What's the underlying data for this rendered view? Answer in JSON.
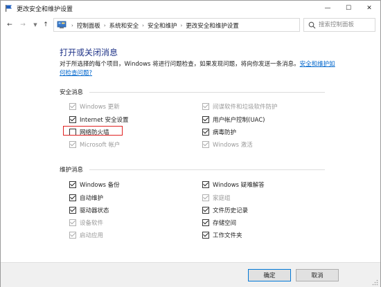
{
  "window": {
    "title": "更改安全和维护设置",
    "controls": {
      "minimize": "—",
      "maximize": "☐",
      "close": "✕"
    }
  },
  "nav": {
    "back": "←",
    "forward": "→",
    "up": "↑",
    "breadcrumbs": [
      "控制面板",
      "系统和安全",
      "安全和维护",
      "更改安全和维护设置"
    ],
    "search_placeholder": "搜索控制面板"
  },
  "page": {
    "heading": "打开或关闭消息",
    "description": "对于所选择的每个项目，Windows 将进行问题检查，如果发现问题，将向你发送一条消息。",
    "description_link": "安全和维护如何检查问题?"
  },
  "security_section": {
    "title": "安全消息",
    "items": [
      {
        "label": "Windows 更新",
        "checked": true,
        "disabled": true
      },
      {
        "label": "间谍软件和垃圾软件防护",
        "checked": true,
        "disabled": true
      },
      {
        "label": "Internet 安全设置",
        "checked": true,
        "disabled": false
      },
      {
        "label": "用户帐户控制(UAC)",
        "checked": true,
        "disabled": false
      },
      {
        "label": "网络防火墙",
        "checked": false,
        "disabled": false
      },
      {
        "label": "病毒防护",
        "checked": true,
        "disabled": false
      },
      {
        "label": "Microsoft 帐户",
        "checked": true,
        "disabled": true
      },
      {
        "label": "Windows 激活",
        "checked": true,
        "disabled": true
      }
    ]
  },
  "maintenance_section": {
    "title": "维护消息",
    "items": [
      {
        "label": "Windows 备份",
        "checked": true,
        "disabled": false
      },
      {
        "label": "Windows 疑难解答",
        "checked": true,
        "disabled": false
      },
      {
        "label": "自动维护",
        "checked": true,
        "disabled": false
      },
      {
        "label": "家庭组",
        "checked": true,
        "disabled": true
      },
      {
        "label": "驱动器状态",
        "checked": true,
        "disabled": false
      },
      {
        "label": "文件历史记录",
        "checked": true,
        "disabled": false
      },
      {
        "label": "设备软件",
        "checked": true,
        "disabled": true
      },
      {
        "label": "存储空间",
        "checked": true,
        "disabled": false
      },
      {
        "label": "启动应用",
        "checked": true,
        "disabled": true
      },
      {
        "label": "工作文件夹",
        "checked": true,
        "disabled": false
      }
    ]
  },
  "footer": {
    "ok_label": "确定",
    "cancel_label": "取消"
  },
  "colors": {
    "heading": "#1e3287",
    "link": "#0066cc",
    "highlight": "#e02020",
    "accent": "#0078d7"
  }
}
